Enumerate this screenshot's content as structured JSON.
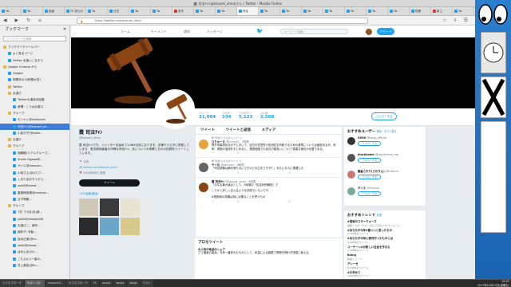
{
  "window": {
    "title": "🏛 司法ﾁｬﾝ(@kasumi_shiro)さん | Twitter - Mozilla Firefox"
  },
  "tabs": [
    "Tw",
    "Tw",
    "結論",
    "TK 夏以の",
    "Tw",
    "日光",
    "Tw",
    "Tw",
    "宮本",
    "Tw",
    "Tw",
    "司法",
    "Tw",
    "Tw",
    "Tw",
    "Tw",
    "Tw",
    "Tw",
    "Tw",
    "知識",
    "新工",
    "Tw"
  ],
  "urlbar": {
    "url": "https://twitter.com/kasumi_shiro"
  },
  "sidebar": {
    "title": "ブックマーク",
    "search_placeholder": "ブックマークを検索",
    "items": [
      {
        "label": "ブックマークツールバー",
        "type": "folder",
        "indent": 0
      },
      {
        "label": "よく見るページ",
        "type": "link",
        "indent": 1
      },
      {
        "label": "Firefox を使いこなそう",
        "type": "link",
        "indent": 1
      },
      {
        "label": "Google Chrome から",
        "type": "folder",
        "indent": 0
      },
      {
        "label": "Google",
        "type": "link",
        "indent": 1
      },
      {
        "label": "短歌年の10秒間大賞！",
        "type": "link",
        "indent": 1
      },
      {
        "label": "Twitter",
        "type": "folder",
        "indent": 1
      },
      {
        "label": "お遊び",
        "type": "folder",
        "indent": 1
      },
      {
        "label": "Twitterの凍結を回避",
        "type": "link",
        "indent": 2
      },
      {
        "label": "新郷・こうばの森で…",
        "type": "link",
        "indent": 2
      },
      {
        "label": "グループ",
        "type": "folder",
        "indent": 1
      },
      {
        "label": "モトヤン@motoyam",
        "type": "link",
        "indent": 2
      },
      {
        "label": "司法ﾁｬﾝ(@kasumi_sh...",
        "type": "link",
        "indent": 2,
        "selected": true
      },
      {
        "label": "小倉方子(@poke…",
        "type": "link",
        "indent": 2
      },
      {
        "label": "お遊び",
        "type": "folder",
        "indent": 1
      },
      {
        "label": "グループ",
        "type": "folder",
        "indent": 1
      },
      {
        "label": "稲穂鋼(リアルグループ…",
        "type": "link",
        "indent": 2
      },
      {
        "label": "Shoko Ogawa@…",
        "type": "link",
        "indent": 2
      },
      {
        "label": "サイエ@(nexusa…",
        "type": "link",
        "indent": 2
      },
      {
        "label": "小林さえ(@(/7/ブ…",
        "type": "link",
        "indent": 2
      },
      {
        "label": "しまたあおそうろう…",
        "type": "link",
        "indent": 2
      },
      {
        "label": "yoikil@shewl…",
        "type": "link",
        "indent": 2
      },
      {
        "label": "藤原徳音様@rcmikaz…",
        "type": "link",
        "indent": 2
      },
      {
        "label": "日子明朗…",
        "type": "link",
        "indent": 2
      },
      {
        "label": "グループ",
        "type": "folder",
        "indent": 1
      },
      {
        "label": "T沢「13日(月)新…",
        "type": "link",
        "indent": 2
      },
      {
        "label": "yoikil@shewkoi08",
        "type": "link",
        "indent": 2
      },
      {
        "label": "お遊びこ。新作…",
        "type": "link",
        "indent": 2
      },
      {
        "label": "稲年子: 年齢…",
        "type": "link",
        "indent": 2
      },
      {
        "label": "桜木正美(@m…",
        "type": "link",
        "indent": 2
      },
      {
        "label": "yoikil@shewl…",
        "type": "link",
        "indent": 2
      },
      {
        "label": "ばゆんまの小…",
        "type": "link",
        "indent": 2
      },
      {
        "label": "こたえ&リー者の…",
        "type": "link",
        "indent": 2
      },
      {
        "label": "井上美佐(@lin…",
        "type": "link",
        "indent": 2
      }
    ]
  },
  "twnav": {
    "home": "ホーム",
    "moments": "モーメント",
    "notifications": "通知",
    "messages": "メッセージ",
    "search_placeholder": "キーワード検索",
    "tweet": "ツイート"
  },
  "stats": [
    {
      "label": "ツイート",
      "value": "31,004"
    },
    {
      "label": "フォロー",
      "value": "334"
    },
    {
      "label": "フォロワー",
      "value": "5,123"
    },
    {
      "label": "いいね",
      "value": "2,508"
    }
  ],
  "follow_label": "フォローする",
  "profile": {
    "name": "霞 司法ﾁｬﾝ",
    "handle": "@kasumi_shiro",
    "bio": "霞 司法ﾁｬﾝです。ツイッターを始めて2,684日目になります。法律クラスタに所属しています。憲法無効論者の冷静な司法ﾁｬﾝ。法についての考察と日々の記録をツイートしています。",
    "location": "日本",
    "link": "twitter.com/kasumi_shiro",
    "joined": "2009年6月に登録",
    "dm": "ツイート",
    "media_header": "133 画像/動画"
  },
  "timeline": {
    "tabs": [
      "ツイート",
      "ツイートと返信",
      "メディア"
    ],
    "tweets": [
      {
        "rt": "霞 司法ﾁｬﾝさんがリツイート",
        "name": "ひりゅーる",
        "handle": "@hiryu03",
        "time": "7時間",
        "text": "現行刑事訴訟法の下において、自白の任意性や信用性を判断するための基準については諸説あるが、判例・実務の運用をまとめると、捜査段階での自白の取扱いについて慎重な検討が必要である。"
      },
      {
        "rt": "霞 司法ﾁｬﾝさんがリツイート",
        "name": "サイ丸",
        "handle": "@saimaru",
        "time": "8時間",
        "text": "「司法試験は絶対落ちないですけど大丈夫ですか？」みたいな人に遭遇した"
      },
      {
        "rt": "",
        "name": "霞 司法ﾁｬﾝ",
        "handle": "@kasumi_shiro",
        "time": "9時間",
        "text": "「次なる最大論点として、5時間の「民法判例解説」で"
      },
      {
        "rt": "",
        "name": "",
        "handle": "",
        "time": "",
        "text": "こうかく詳しく言えるような状態でいたいです。"
      },
      {
        "rt": "",
        "name": "",
        "handle": "",
        "time": "",
        "text": "#短期用の試験は特に必要なことを思うもの"
      }
    ],
    "promo_title": "プロモツイート",
    "promo_name": "大人気の商品のシェア",
    "promo_text": "さて最新の製品、今年一番売れたものとして、体温による調整で季節を問わず快適に使える。"
  },
  "suggestions": {
    "title": "おすすめユーザー",
    "links": "更新 · すべて表示",
    "users": [
      {
        "name": "SKOG",
        "handle": "@skog_official",
        "follow": "フォローする"
      },
      {
        "name": "blackhome",
        "handle": "@blackhome_org",
        "follow": "フォローする"
      },
      {
        "name": "藤倉さおり(さおりん)",
        "handle": "@fujikura",
        "follow": "フォローする"
      },
      {
        "name": "サイエ",
        "handle": "@nexusa",
        "follow": "フォローする"
      }
    ]
  },
  "trends": {
    "title": "おすすめトレンド",
    "links": "変更",
    "items": [
      {
        "t": "#宝塚のスターウォーズ",
        "c": "宝塚とスターウォーズのコラボについてツイート"
      },
      {
        "t": "#あなたが今年1番いいと思ったもの",
        "c": "2,415件のツイート"
      },
      {
        "t": "#あなたが今年に絶対行ったものとは",
        "c": "3,102件のツイート"
      },
      {
        "t": "ユーチーン#が新しい社会を作るな",
        "c": "1,208件のツイート"
      },
      {
        "t": "Boing",
        "c": "新着ニュース"
      },
      {
        "t": "グレーゼ",
        "c": "5,331件のツイート"
      },
      {
        "t": "#お早めて",
        "c": "1,847件のツイート"
      }
    ]
  },
  "taskbar": {
    "items": [
      "エクスプローラ",
      "司法ﾁｬﾝ(@...",
      "emacs23...",
      "エクスプローラ",
      "Tk",
      "xclock",
      "xeyes",
      "xlogo",
      "テスト"
    ],
    "time": "19:42",
    "date": "2017年12月15日(金曜日)"
  },
  "colors": {
    "accent": "#1da1f2",
    "link": "#1b95e0",
    "page_bg": "#e6ecf0",
    "desktop": "#1a62b0"
  }
}
